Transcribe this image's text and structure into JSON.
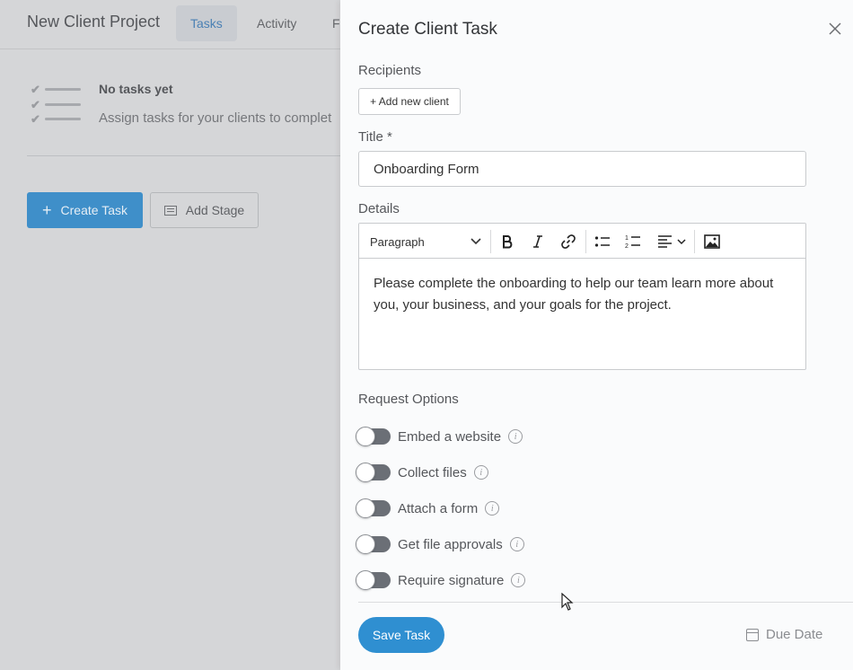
{
  "background": {
    "project_title": "New Client Project",
    "tabs": [
      {
        "label": "Tasks",
        "active": true
      },
      {
        "label": "Activity",
        "active": false
      },
      {
        "label": "F",
        "active": false
      }
    ],
    "empty_title": "No tasks yet",
    "empty_subtitle": "Assign tasks for your clients to complet",
    "create_task_label": "Create Task",
    "add_stage_label": "Add Stage"
  },
  "drawer": {
    "title": "Create Client Task",
    "recipients_label": "Recipients",
    "add_client_label": "+ Add new client",
    "title_label": "Title *",
    "title_value": "Onboarding Form",
    "details_label": "Details",
    "paragraph_style": "Paragraph",
    "details_text": "Please complete the onboarding to help our team learn more about you, your business, and your goals for the project.",
    "request_options_label": "Request Options",
    "options": [
      {
        "label": "Embed a website",
        "enabled": false
      },
      {
        "label": "Collect files",
        "enabled": false
      },
      {
        "label": "Attach a form",
        "enabled": false
      },
      {
        "label": "Get file approvals",
        "enabled": false
      },
      {
        "label": "Require signature",
        "enabled": false
      }
    ],
    "save_label": "Save Task",
    "due_date_label": "Due Date"
  },
  "colors": {
    "accent": "#2f8fd1",
    "toggle_off": "#6b6f76",
    "overlay": "#d5d6d8"
  }
}
